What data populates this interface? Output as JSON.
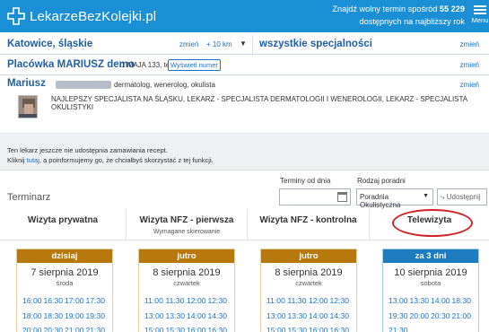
{
  "header": {
    "logo_text": "LekarzeBezKolejki.pl",
    "find_text_prefix": "Znajdź wolny termin spośród",
    "find_count": "55 229",
    "find_text_suffix": "dostępnych na najbliższy rok",
    "menu_label": "Menu"
  },
  "location": {
    "title": "Katowice, śląskie",
    "change": "zmień",
    "radius": "+ 10 km",
    "caret": "▼"
  },
  "specialty": {
    "title": "wszystkie specjalności",
    "change": "zmień"
  },
  "clinic": {
    "name": "Placówka MARIUSZ demo",
    "address": "1 MAJA 133, tel.",
    "phone_button": "Wyświetl numer",
    "change": "zmień"
  },
  "doctor": {
    "name": "Mariusz",
    "specialties": "dermatolog, wenerolog, okulista",
    "change": "zmień",
    "description": "NAJLEPSZY SPECJALISTA NA ŚLĄSKU, LEKARZ - SPECJALISTA DERMATOLOGII I WENEROLOGII, LEKARZ - SPECJALISTA OKULISTYKI"
  },
  "notice": {
    "line1": "Ten lekarz jeszcze nie udostępnia zamawiania recept.",
    "line2_prefix": "Kliknij ",
    "line2_link": "tutaj",
    "line2_suffix": ", a poinformujemy go, że chciałbyś skorzystać z tej funkcji."
  },
  "filters": {
    "date_label": "Terminy od dnia",
    "clinic_type_label": "Rodzaj poradni",
    "clinic_type_value": "Poradnia Okulistyczna",
    "share_label": "Udostępnij"
  },
  "section_title": "Terminarz",
  "tabs": [
    {
      "label": "Wizyta prywatna",
      "sub": ""
    },
    {
      "label": "Wizyta NFZ - pierwsza",
      "sub": "Wymagane skierowanie"
    },
    {
      "label": "Wizyta NFZ - kontrolna",
      "sub": ""
    },
    {
      "label": "Telewizyta",
      "sub": ""
    }
  ],
  "days": [
    {
      "header": "dzisiaj",
      "date": "7 sierpnia 2019",
      "dow": "środa",
      "slots": [
        "16:00",
        "16:30",
        "17:00",
        "17:30",
        "18:00",
        "18:30",
        "19:00",
        "19:30",
        "20:00",
        "20:30",
        "21:00",
        "21:30"
      ]
    },
    {
      "header": "jutro",
      "date": "8 sierpnia 2019",
      "dow": "czwartek",
      "slots": [
        "11:00",
        "11:30",
        "12:00",
        "12:30",
        "13:00",
        "13:30",
        "14:00",
        "14:30",
        "15:00",
        "15:30",
        "16:00",
        "16:30"
      ]
    },
    {
      "header": "jutro",
      "date": "8 sierpnia 2019",
      "dow": "czwartek",
      "slots": [
        "11:00",
        "11:30",
        "12:00",
        "12:30",
        "13:00",
        "13:30",
        "14:00",
        "14:30",
        "15:00",
        "15:30",
        "16:00",
        "16:30"
      ]
    },
    {
      "header": "za 3 dni",
      "date": "10 sierpnia 2019",
      "dow": "sobota",
      "slots": [
        "13:00",
        "13:30",
        "14:00",
        "18:30",
        "19:30",
        "20:00",
        "20:30",
        "21:00",
        "21:30"
      ]
    }
  ],
  "colors": {
    "brand_blue": "#1a8fd6",
    "day_header_gold": "#b7790e",
    "day_header_blue": "#1d7bc0",
    "highlight_circle": "#d1232a"
  }
}
